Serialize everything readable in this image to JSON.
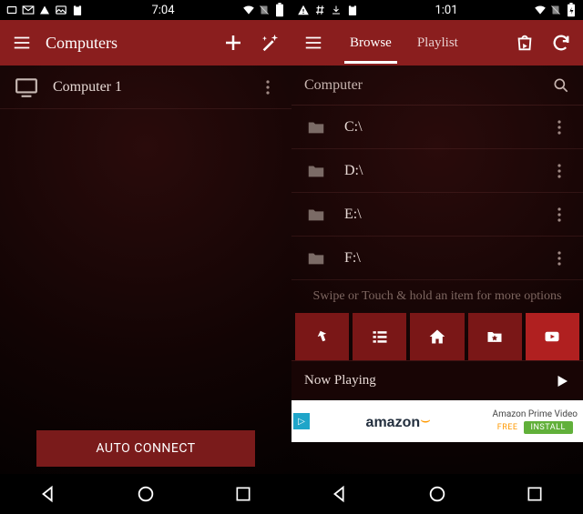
{
  "left": {
    "status": {
      "time": "7:04"
    },
    "toolbar": {
      "title": "Computers"
    },
    "rows": [
      {
        "label": "Computer 1"
      }
    ],
    "auto_connect": "AUTO CONNECT"
  },
  "right": {
    "status": {
      "time": "1:01"
    },
    "tabs": {
      "browse": "Browse",
      "playlist": "Playlist"
    },
    "search": {
      "label": "Computer"
    },
    "drives": [
      {
        "label": "C:\\"
      },
      {
        "label": "D:\\"
      },
      {
        "label": "E:\\"
      },
      {
        "label": "F:\\"
      }
    ],
    "hint": "Swipe or Touch & hold an item for more options",
    "now_playing": "Now Playing",
    "ad": {
      "brand": "amazon",
      "title": "Amazon Prime Video",
      "free": "FREE",
      "install": "INSTALL"
    }
  }
}
